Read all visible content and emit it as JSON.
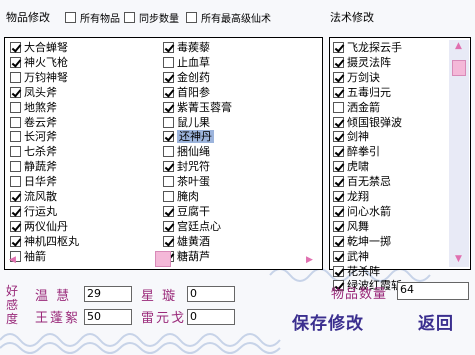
{
  "header": {
    "item_edit_title": "物品修改",
    "all_items_label": "所有物品",
    "sync_count_label": "同步数量",
    "all_best_label": "所有最高级仙术",
    "spell_edit_title": "法术修改"
  },
  "items_col1": [
    {
      "label": "大合蝉弩",
      "checked": true
    },
    {
      "label": "神火飞枪",
      "checked": true
    },
    {
      "label": "万钧神弩",
      "checked": false
    },
    {
      "label": "凤头斧",
      "checked": true
    },
    {
      "label": "地煞斧",
      "checked": false
    },
    {
      "label": "卷云斧",
      "checked": false
    },
    {
      "label": "长河斧",
      "checked": false
    },
    {
      "label": "七杀斧",
      "checked": false
    },
    {
      "label": "静蔬斧",
      "checked": false
    },
    {
      "label": "日华斧",
      "checked": false
    },
    {
      "label": "流风散",
      "checked": true
    },
    {
      "label": "行运丸",
      "checked": true
    },
    {
      "label": "两仪仙丹",
      "checked": true
    },
    {
      "label": "神机四枢丸",
      "checked": true
    },
    {
      "label": "袖箭",
      "checked": false
    }
  ],
  "items_col2": [
    {
      "label": "毒蒺藜",
      "checked": true,
      "selected": false
    },
    {
      "label": "止血草",
      "checked": false,
      "selected": false
    },
    {
      "label": "金创药",
      "checked": true,
      "selected": false
    },
    {
      "label": "首阳参",
      "checked": true,
      "selected": false
    },
    {
      "label": "紫菁玉蓉膏",
      "checked": true,
      "selected": false
    },
    {
      "label": "鼠儿果",
      "checked": false,
      "selected": false
    },
    {
      "label": "还神丹",
      "checked": true,
      "selected": true
    },
    {
      "label": "捆仙绳",
      "checked": false,
      "selected": false
    },
    {
      "label": "封咒符",
      "checked": true,
      "selected": false
    },
    {
      "label": "茶叶蛋",
      "checked": false,
      "selected": false
    },
    {
      "label": "腌肉",
      "checked": false,
      "selected": false
    },
    {
      "label": "豆腐干",
      "checked": true,
      "selected": false
    },
    {
      "label": "宫廷点心",
      "checked": true,
      "selected": false
    },
    {
      "label": "雄黄酒",
      "checked": true,
      "selected": false
    },
    {
      "label": "糖葫芦",
      "checked": true,
      "selected": false
    }
  ],
  "spells": [
    {
      "label": "飞龙探云手",
      "checked": true
    },
    {
      "label": "摄灵法阵",
      "checked": true
    },
    {
      "label": "万剑诀",
      "checked": true
    },
    {
      "label": "五毒归元",
      "checked": true
    },
    {
      "label": "洒金箭",
      "checked": false
    },
    {
      "label": "倾国银弹波",
      "checked": true
    },
    {
      "label": "剑神",
      "checked": true
    },
    {
      "label": "醉拳引",
      "checked": true
    },
    {
      "label": "虎啸",
      "checked": true
    },
    {
      "label": "百无禁忌",
      "checked": true
    },
    {
      "label": "龙翔",
      "checked": true
    },
    {
      "label": "问心水箭",
      "checked": true
    },
    {
      "label": "风舞",
      "checked": true
    },
    {
      "label": "乾坤一掷",
      "checked": true
    },
    {
      "label": "武神",
      "checked": true
    },
    {
      "label": "花杀阵",
      "checked": true
    },
    {
      "label": "绿波红霞斩",
      "checked": true
    }
  ],
  "stats": {
    "side_label_1": "好",
    "side_label_2": "感",
    "side_label_3": "度",
    "wen_hui_label": "温 慧",
    "wen_hui_value": "29",
    "xing_xuan_label": "星 璇",
    "xing_xuan_value": "0",
    "wang_pengxu_label": "王蓬絮",
    "wang_pengxu_value": "50",
    "lei_yuange_label": "雷元戈",
    "lei_yuange_value": "0"
  },
  "item_count": {
    "label": "物品数量",
    "value": "64"
  },
  "buttons": {
    "save_label": "保存修改",
    "back_label": "返回"
  },
  "colors": {
    "accent_purple": "#9a2a7a",
    "button_text": "#3b2f8f",
    "selection": "#9cb4dc",
    "scroll_thumb": "#f4b8d8"
  }
}
